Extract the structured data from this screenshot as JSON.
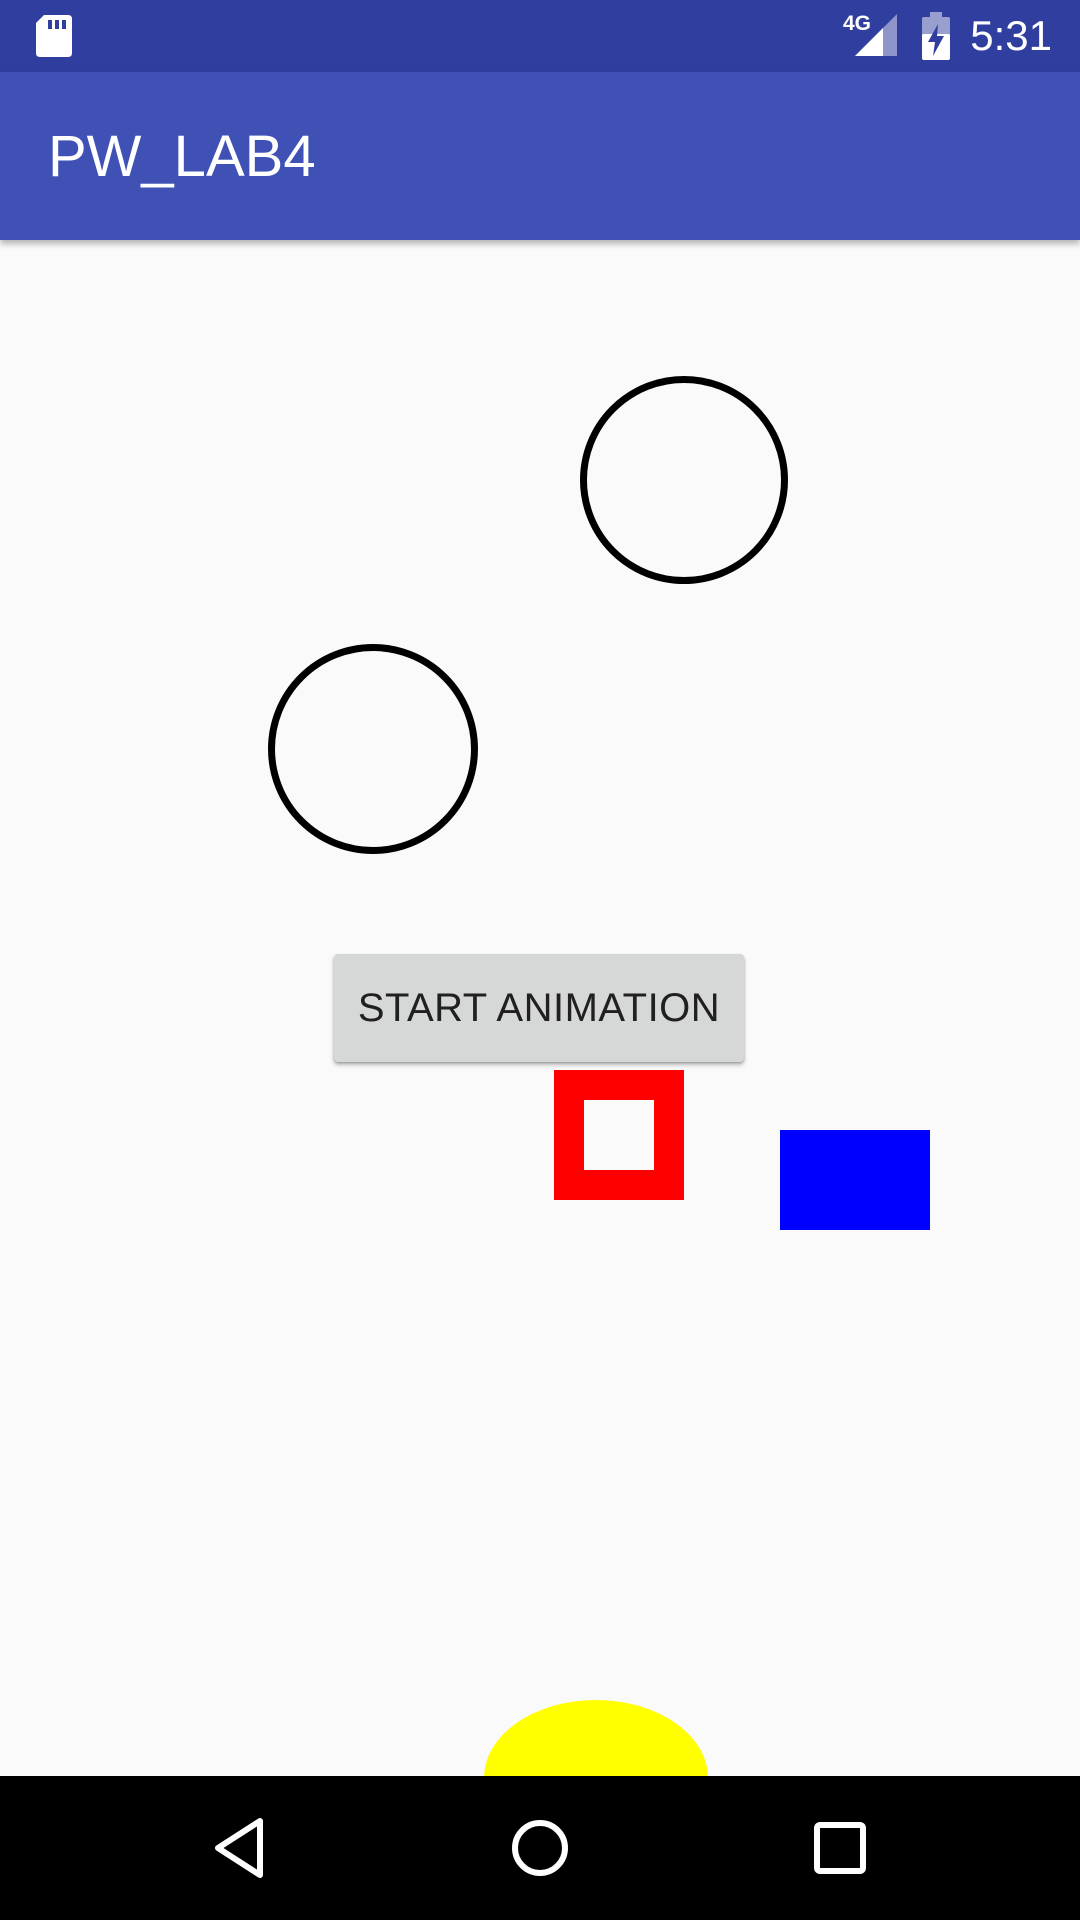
{
  "status_bar": {
    "network_type": "4G",
    "time": "5:31",
    "background_color": "#303f9f",
    "icons": [
      "sd-card-icon",
      "cell-signal-icon",
      "battery-charging-icon"
    ]
  },
  "app_bar": {
    "title": "PW_LAB4",
    "background_color": "#3f51b5"
  },
  "canvas": {
    "shapes": [
      {
        "name": "circle-outline",
        "color": "#000000"
      },
      {
        "name": "circle-outline",
        "color": "#000000"
      },
      {
        "name": "square-outline",
        "color": "#ff0000"
      },
      {
        "name": "filled-rectangle",
        "color": "#0000ff"
      },
      {
        "name": "filled-oval",
        "color": "#ffff00"
      }
    ],
    "start_button": {
      "label": "START ANIMATION"
    }
  },
  "nav_bar": {
    "icons": [
      "back-icon",
      "home-icon",
      "recents-icon"
    ]
  }
}
